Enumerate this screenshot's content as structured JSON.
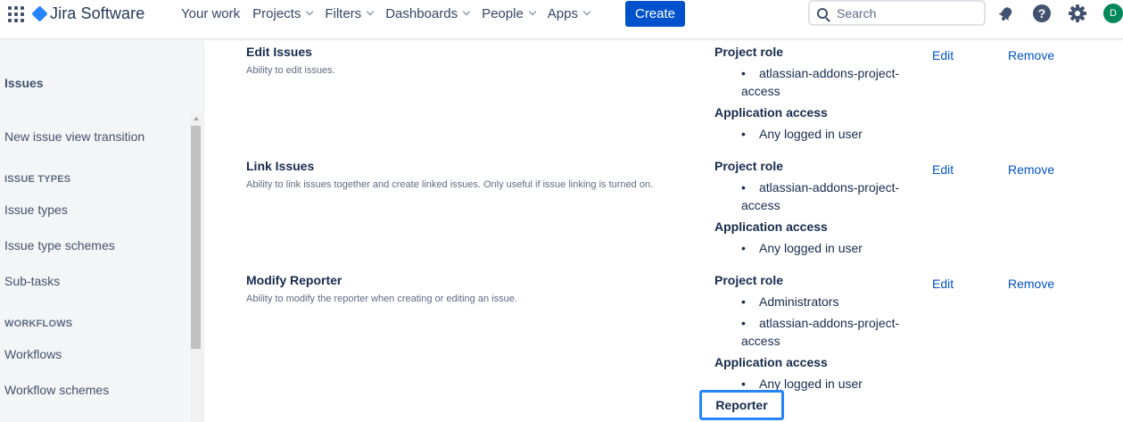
{
  "header": {
    "product_name": "Jira Software",
    "nav": [
      {
        "label": "Your work",
        "has_menu": false
      },
      {
        "label": "Projects",
        "has_menu": true
      },
      {
        "label": "Filters",
        "has_menu": true
      },
      {
        "label": "Dashboards",
        "has_menu": true
      },
      {
        "label": "People",
        "has_menu": true
      },
      {
        "label": "Apps",
        "has_menu": true
      }
    ],
    "create_label": "Create",
    "search_placeholder": "Search",
    "avatar_initial": "D",
    "icons": [
      "notifications-icon",
      "help-icon",
      "settings-icon"
    ],
    "colors": {
      "brand": "#0052cc",
      "logo": "#2684ff",
      "avatar": "#00875a"
    }
  },
  "sidebar": {
    "heading": "Issues",
    "items": [
      {
        "label": "New issue view transition"
      },
      {
        "section": "ISSUE TYPES"
      },
      {
        "label": "Issue types"
      },
      {
        "label": "Issue type schemes"
      },
      {
        "label": "Sub-tasks"
      },
      {
        "section": "WORKFLOWS"
      },
      {
        "label": "Workflows"
      },
      {
        "label": "Workflow schemes"
      }
    ]
  },
  "permissions": [
    {
      "title": "Edit Issues",
      "description": "Ability to edit issues.",
      "project_role_label": "Project role",
      "project_roles": [
        "atlassian-addons-project-access"
      ],
      "app_access_label": "Application access",
      "app_access": [
        "Any logged in user"
      ],
      "edit_label": "Edit",
      "remove_label": "Remove"
    },
    {
      "title": "Link Issues",
      "description": "Ability to link issues together and create linked issues. Only useful if issue linking is turned on.",
      "project_role_label": "Project role",
      "project_roles": [
        "atlassian-addons-project-access"
      ],
      "app_access_label": "Application access",
      "app_access": [
        "Any logged in user"
      ],
      "edit_label": "Edit",
      "remove_label": "Remove"
    },
    {
      "title": "Modify Reporter",
      "description": "Ability to modify the reporter when creating or editing an issue.",
      "project_role_label": "Project role",
      "project_roles": [
        "Administrators",
        "atlassian-addons-project-access"
      ],
      "app_access_label": "Application access",
      "app_access": [
        "Any logged in user"
      ],
      "extra_grant": "Reporter",
      "edit_label": "Edit",
      "remove_label": "Remove"
    }
  ]
}
